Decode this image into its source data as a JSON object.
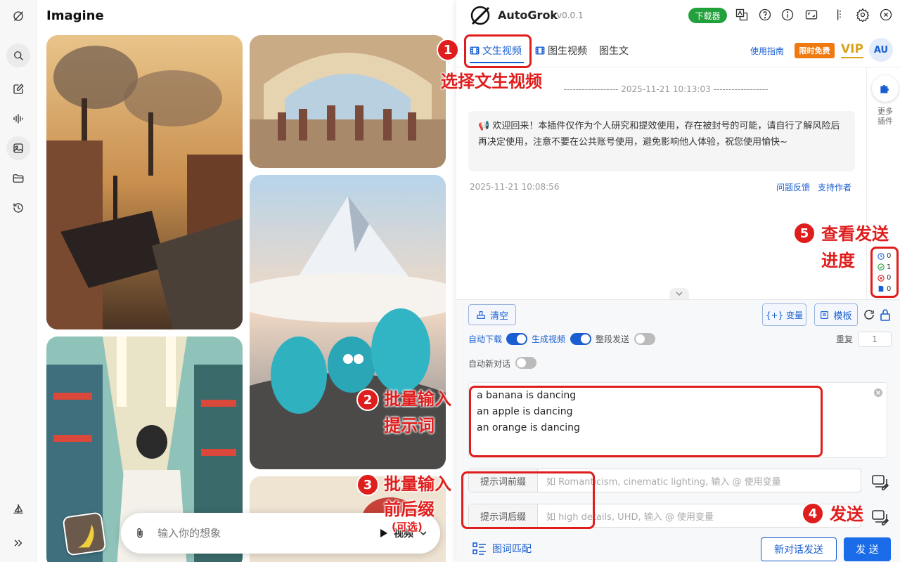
{
  "app": {
    "title": "Imagine"
  },
  "chat": {
    "placeholder": "输入你的想象",
    "mode_label": "视频"
  },
  "panel": {
    "brand": "AutoGrok",
    "version": "v0.0.1",
    "download_badge": "下载器",
    "tabs": [
      {
        "label": "文生视频"
      },
      {
        "label": "图生视频"
      },
      {
        "label": "图生文"
      }
    ],
    "guide_link": "使用指南",
    "promo_badge": "限时免费",
    "vip_label": "VIP",
    "avatar_initials": "AU",
    "divider_timestamp": "------------------ 2025-11-21 10:13:03 ------------------",
    "welcome_message": "📢 欢迎回来！本插件仅作为个人研究和提效使用，存在被封号的可能，请自行了解风险后再决定使用，注意不要在公共账号使用，避免影响他人体验，祝您使用愉快~",
    "message_time": "2025-11-21 10:08:56",
    "feedback_link": "问题反馈",
    "support_link": "支持作者",
    "more_plugins": "更多插件",
    "progress": {
      "pending": "0",
      "success": "1",
      "failed": "0",
      "docs": "0"
    },
    "clear_button": "清空",
    "variable_button": "{+} 变量",
    "template_button": "模板",
    "toggles": {
      "auto_download": "自动下载",
      "generate_video": "生成视频",
      "segment_send": "整段发送",
      "auto_new_chat": "自动新对话"
    },
    "toggle_state": {
      "auto_download": true,
      "generate_video": true,
      "segment_send": false,
      "auto_new_chat": false
    },
    "repeat_label": "重复",
    "repeat_value": "1",
    "prompts": [
      "a banana is dancing",
      "an apple is dancing",
      "an orange is dancing"
    ],
    "prefix_label": "提示词前缀",
    "prefix_placeholder": "如 Romanticism, cinematic lighting, 输入 @ 使用变量",
    "suffix_label": "提示词后缀",
    "suffix_placeholder": "如 high details, UHD, 输入 @ 使用变量",
    "image_match": "图词匹配",
    "new_chat_send": "新对话发送",
    "send_button": "发 送"
  },
  "annotations": [
    {
      "num": "1",
      "text": "选择文生视频"
    },
    {
      "num": "2",
      "text": "批量输入",
      "text2": "提示词"
    },
    {
      "num": "3",
      "text": "批量输入",
      "text2": "前后缀",
      "note": "(可选)"
    },
    {
      "num": "4",
      "text": "发送"
    },
    {
      "num": "5",
      "text": "查看发送",
      "text2": "进度"
    }
  ],
  "colors": {
    "accent": "#1a5fd1",
    "annotation_red": "#e01d1d",
    "download_green": "#22a03c",
    "promo_orange": "#f07a12",
    "vip_gold": "#d9a21b"
  }
}
